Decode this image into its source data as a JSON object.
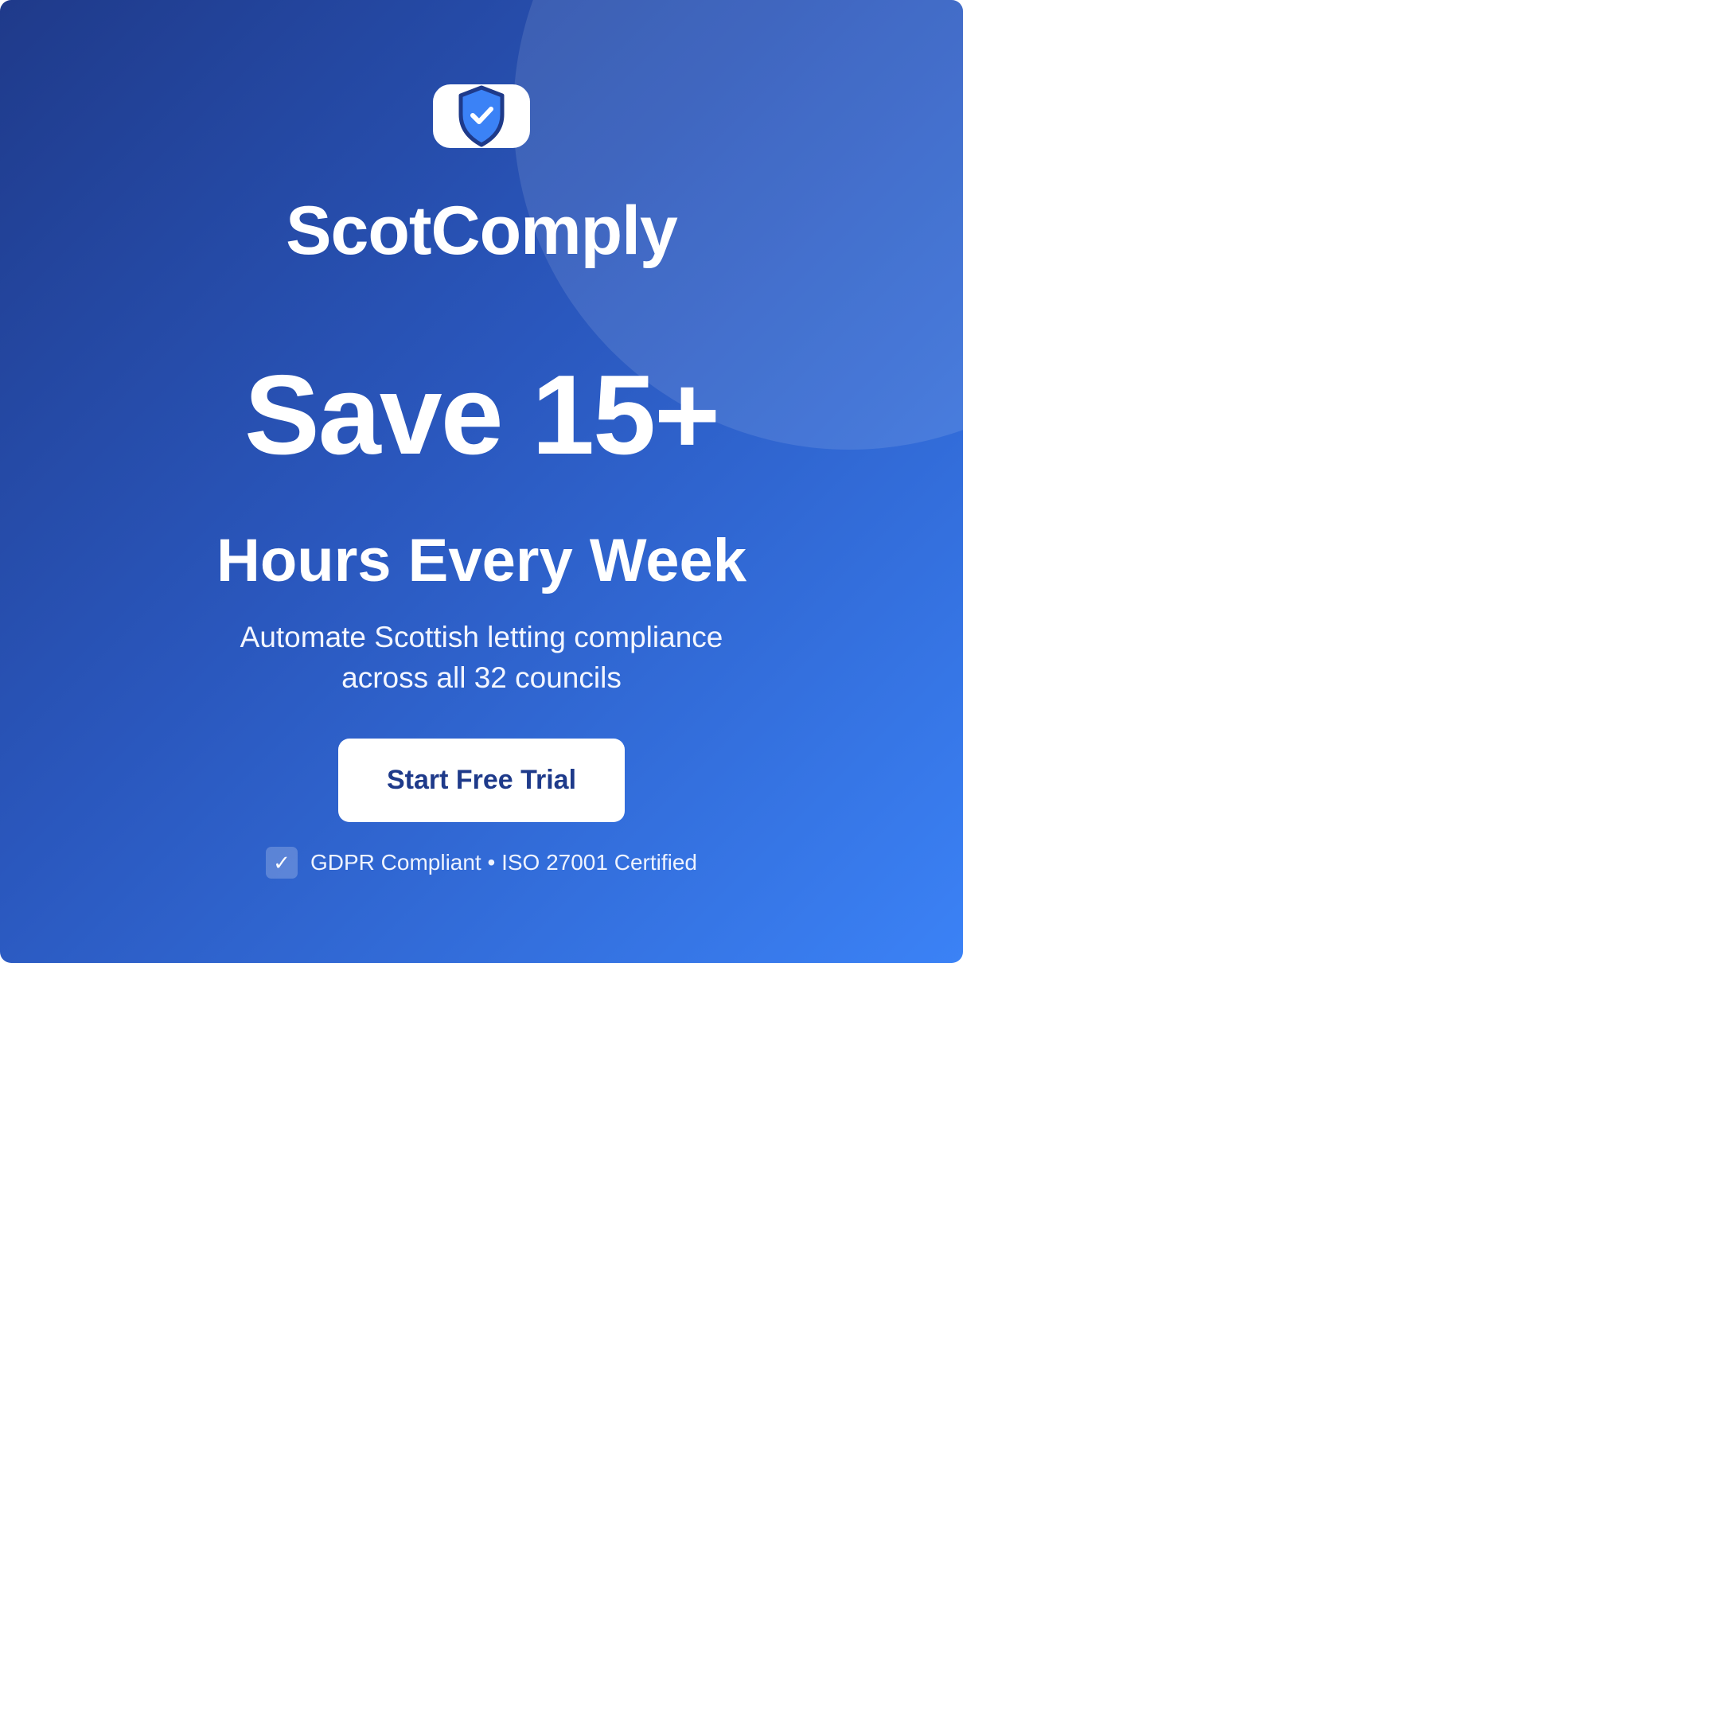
{
  "brand": {
    "logo_icon": "shield-check-icon",
    "name": "ScotComply"
  },
  "hero": {
    "headline": "Save 15+",
    "subheadline": "Hours Every Week",
    "tagline": "Automate Scottish letting compliance across all 32 councils"
  },
  "cta": {
    "label": "Start Free Trial"
  },
  "trust": {
    "icon": "checkmark",
    "icon_glyph": "✓",
    "text": "GDPR Compliant • ISO 27001 Certified"
  },
  "colors": {
    "gradient_start": "#1f3a8a",
    "gradient_end": "#3b82f6",
    "cta_text": "#1e3a8a",
    "shield_fill": "#3b82f6",
    "shield_outline": "#1e3a8a"
  }
}
